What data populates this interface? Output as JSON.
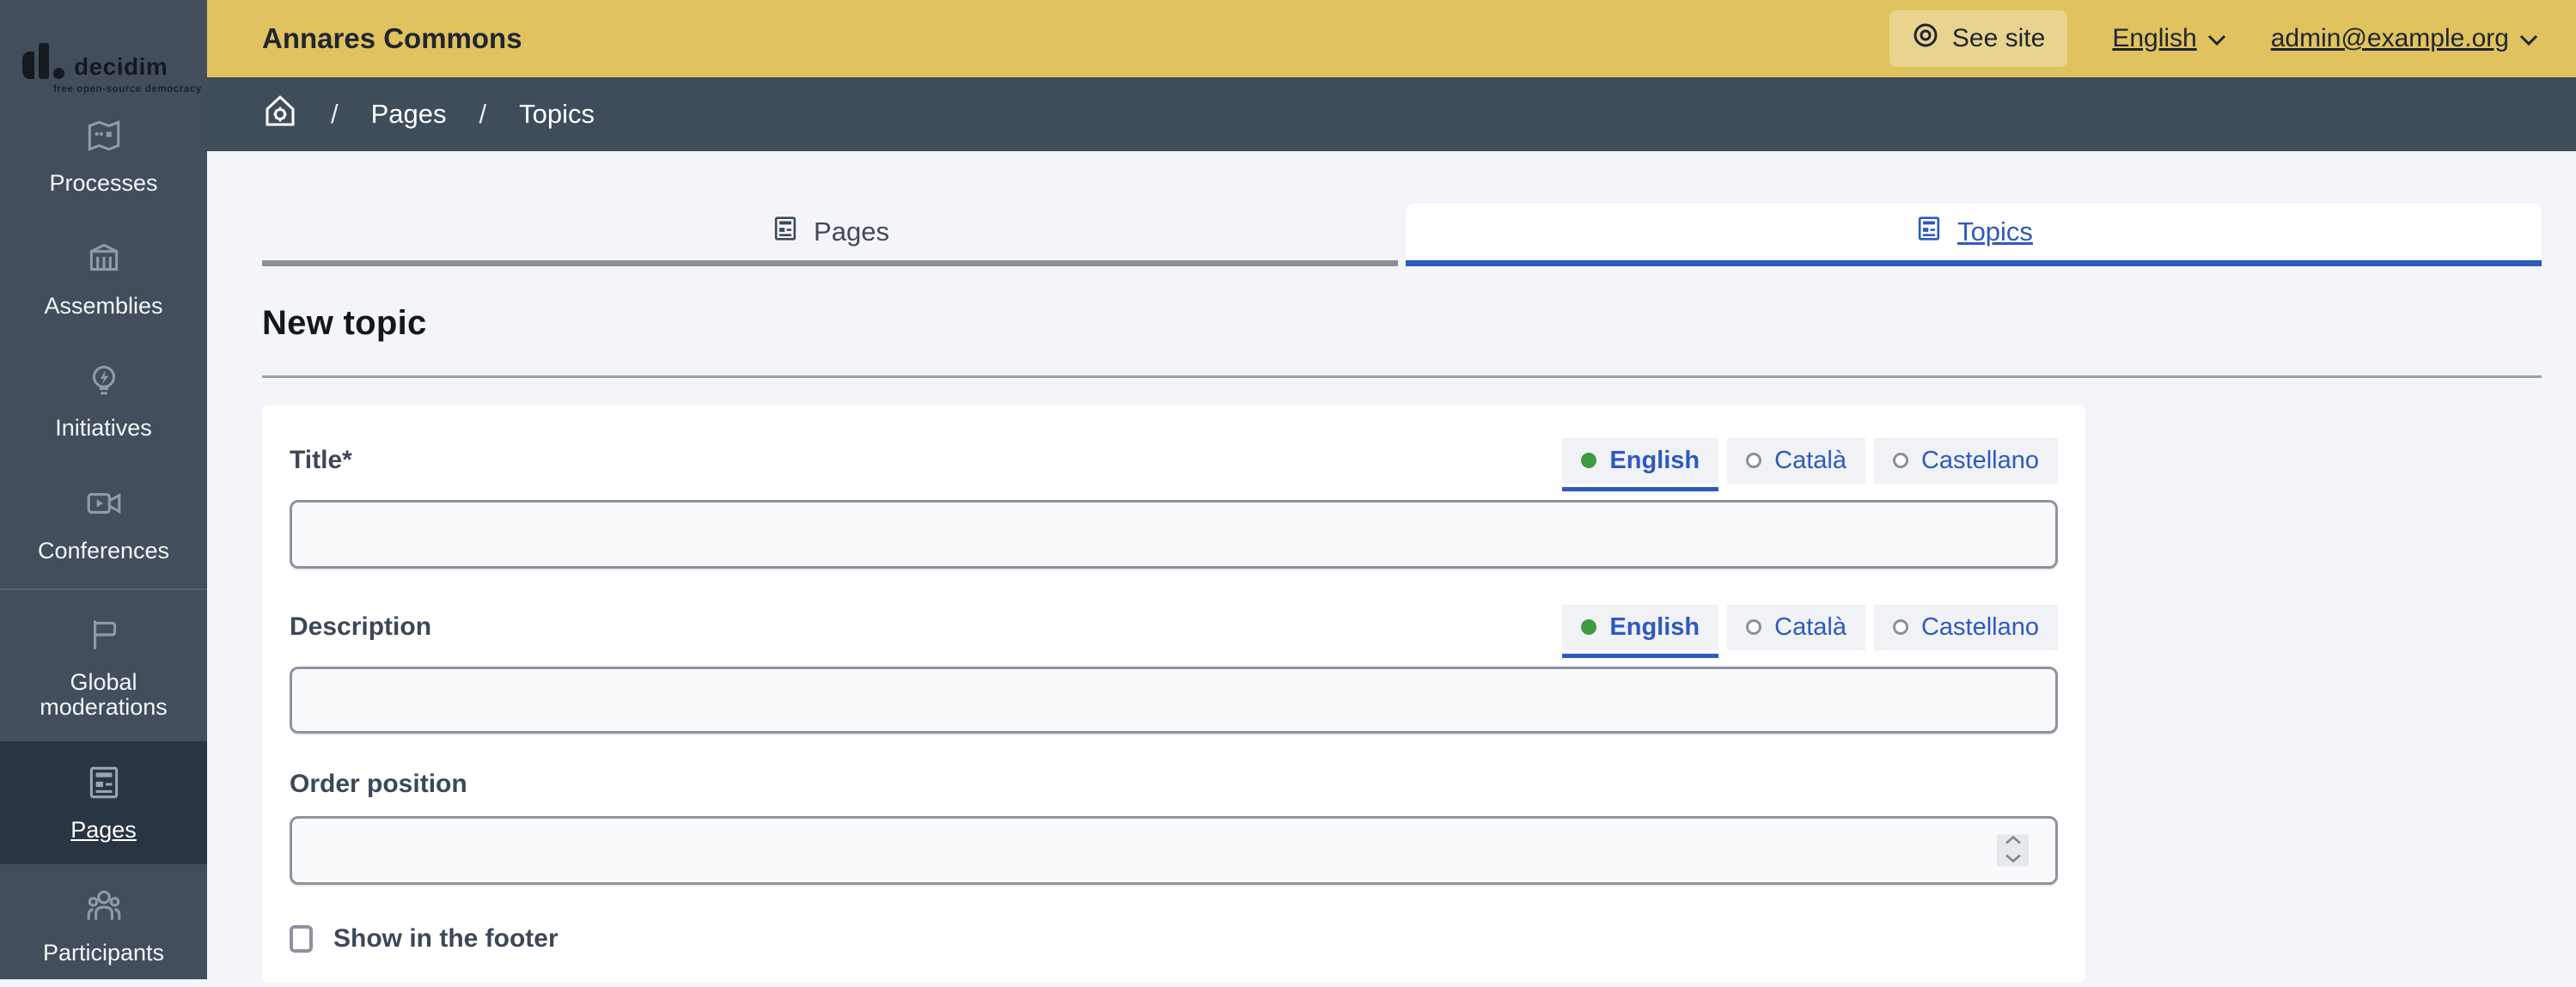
{
  "brand": {
    "logo_text": "decidim",
    "logo_tagline": "free open-source democracy"
  },
  "header": {
    "title": "Annares Commons",
    "see_site_label": "See site",
    "language_label": "English",
    "account_label": "admin@example.org"
  },
  "breadcrumb": {
    "separator": "/",
    "items": [
      "Pages",
      "Topics"
    ]
  },
  "sidebar": {
    "items": [
      {
        "label": "Processes"
      },
      {
        "label": "Assemblies"
      },
      {
        "label": "Initiatives"
      },
      {
        "label": "Conferences"
      },
      {
        "label": "Global moderations"
      },
      {
        "label": "Pages"
      },
      {
        "label": "Participants"
      }
    ],
    "active_item": "Pages"
  },
  "tabs": [
    {
      "label": "Pages",
      "active": false
    },
    {
      "label": "Topics",
      "active": true
    }
  ],
  "page": {
    "heading": "New topic"
  },
  "form": {
    "languages": [
      "English",
      "Català",
      "Castellano"
    ],
    "selected_language": "English",
    "title_label": "Title*",
    "title_value": "",
    "description_label": "Description",
    "description_value": "",
    "order_label": "Order position",
    "order_value": "",
    "footer_checkbox_label": "Show in the footer",
    "footer_checkbox_checked": false
  },
  "colors": {
    "header_yellow": "#e0c25f",
    "sidebar_dark": "#424e5c",
    "accent_blue": "#2e59c0",
    "radio_green": "#3f9b41"
  }
}
